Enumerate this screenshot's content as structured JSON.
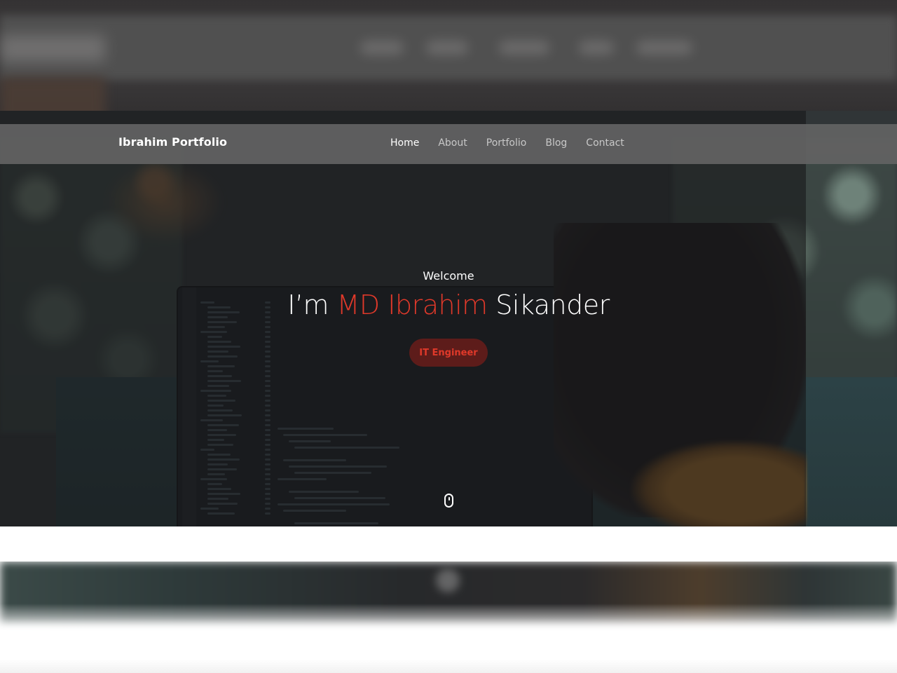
{
  "navbar": {
    "brand": "Ibrahim Portfolio",
    "links": [
      {
        "label": "Home",
        "active": true
      },
      {
        "label": "About",
        "active": false
      },
      {
        "label": "Portfolio",
        "active": false
      },
      {
        "label": "Blog",
        "active": false
      },
      {
        "label": "Contact",
        "active": false
      }
    ]
  },
  "hero": {
    "welcome": "Welcome",
    "headline_prefix": "I’m ",
    "headline_accent": "MD Ibrahim",
    "headline_suffix": " Sikander",
    "role": "IT Engineer",
    "scroll_icon": "mouse-icon"
  },
  "colors": {
    "accent": "#e0392a",
    "navbar_bg": "#636363",
    "text": "#ffffff",
    "nav_link": "#c8c8c8"
  }
}
